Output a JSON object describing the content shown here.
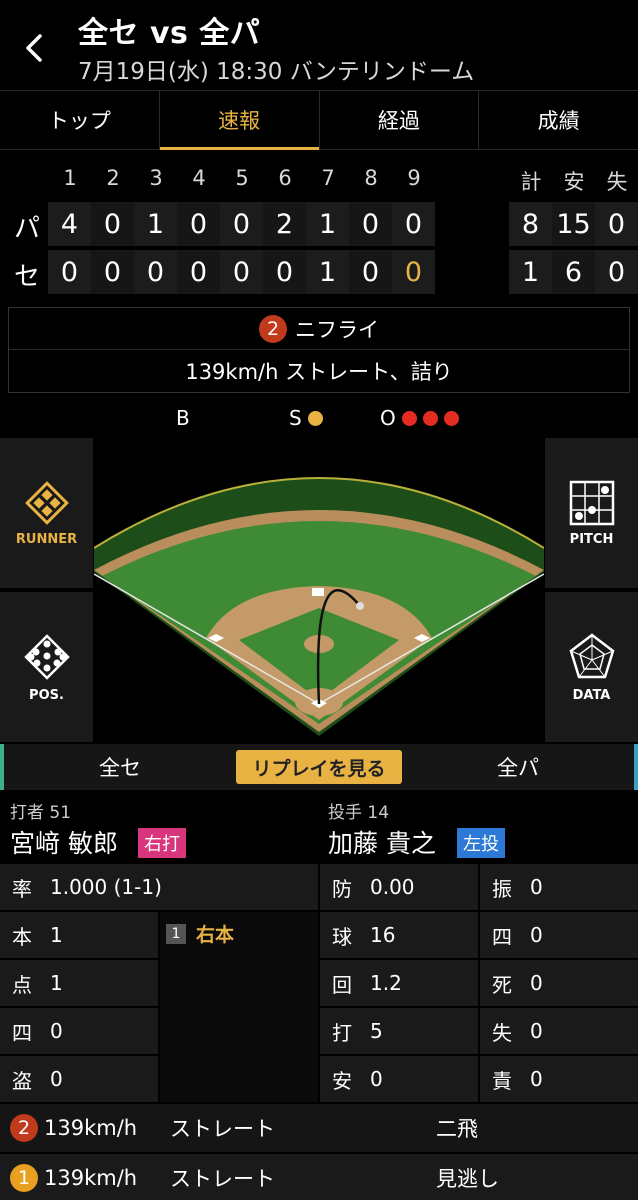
{
  "header": {
    "title": "全セ vs 全パ",
    "subtitle": "7月19日(水) 18:30 バンテリンドーム"
  },
  "tabs": [
    {
      "label": "トップ",
      "active": false
    },
    {
      "label": "速報",
      "active": true
    },
    {
      "label": "経過",
      "active": false
    },
    {
      "label": "成績",
      "active": false
    }
  ],
  "scoreboard": {
    "innings": [
      "1",
      "2",
      "3",
      "4",
      "5",
      "6",
      "7",
      "8",
      "9"
    ],
    "totals_headers": [
      "計",
      "安",
      "失"
    ],
    "rows": [
      {
        "team": "パ",
        "scores": [
          "4",
          "0",
          "1",
          "0",
          "0",
          "2",
          "1",
          "0",
          "0"
        ],
        "totals": [
          "8",
          "15",
          "0"
        ]
      },
      {
        "team": "セ",
        "scores": [
          "0",
          "0",
          "0",
          "0",
          "0",
          "0",
          "1",
          "0",
          "0"
        ],
        "totals": [
          "1",
          "6",
          "0"
        ]
      }
    ]
  },
  "play": {
    "number": "2",
    "result": "ニフライ",
    "detail": "139km/h ストレート、詰り"
  },
  "count": {
    "b_label": "B",
    "s_label": "S",
    "o_label": "O",
    "balls": 0,
    "strikes": 1,
    "outs": 3
  },
  "side_buttons": {
    "runner": "RUNNER",
    "pos": "POS.",
    "pitch": "PITCH",
    "data": "DATA"
  },
  "teams_bar": {
    "left": "全セ",
    "right": "全パ",
    "replay": "リプレイを見る"
  },
  "batter": {
    "role": "打者 51",
    "name": "宮﨑 敏郎",
    "hand": "右打",
    "stats": [
      {
        "k": "率",
        "v": "1.000 (1-1)"
      },
      {
        "k": "本",
        "v": "1"
      },
      {
        "k": "点",
        "v": "1"
      },
      {
        "k": "四",
        "v": "0"
      },
      {
        "k": "盗",
        "v": "0"
      }
    ],
    "at_bat_log": [
      {
        "n": "1",
        "result": "右本"
      }
    ]
  },
  "pitcher": {
    "role": "投手 14",
    "name": "加藤 貴之",
    "hand": "左投",
    "stats_left": [
      {
        "k": "防",
        "v": "0.00"
      },
      {
        "k": "球",
        "v": "16"
      },
      {
        "k": "回",
        "v": "1.2"
      },
      {
        "k": "打",
        "v": "5"
      },
      {
        "k": "安",
        "v": "0"
      }
    ],
    "stats_right": [
      {
        "k": "振",
        "v": "0"
      },
      {
        "k": "四",
        "v": "0"
      },
      {
        "k": "死",
        "v": "0"
      },
      {
        "k": "失",
        "v": "0"
      },
      {
        "k": "責",
        "v": "0"
      }
    ]
  },
  "pitches": [
    {
      "n": "2",
      "speed": "139km/h",
      "type": "ストレート",
      "result": "二飛",
      "color": "#c23a1c"
    },
    {
      "n": "1",
      "speed": "139km/h",
      "type": "ストレート",
      "result": "見逃し",
      "color": "#e9a020"
    }
  ]
}
